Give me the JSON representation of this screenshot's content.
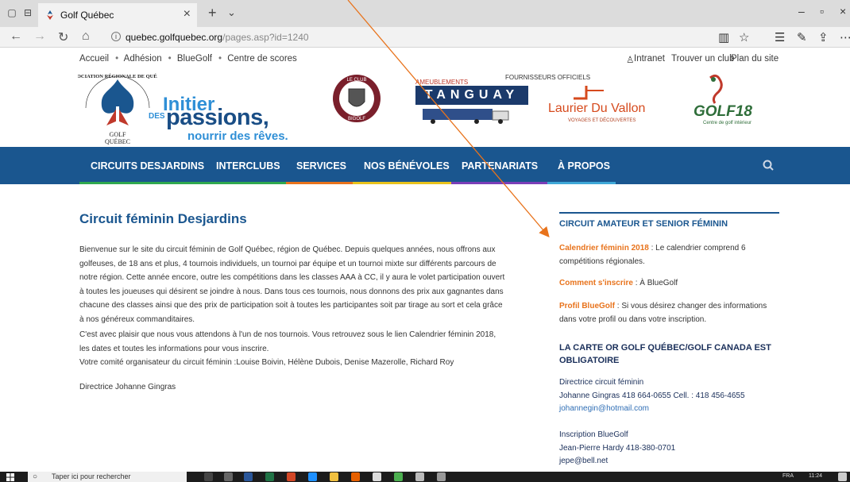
{
  "browser": {
    "tab_title": "Golf Québec",
    "url_host": "quebec.golfquebec.org",
    "url_path": "/pages.asp?id=1240"
  },
  "site": {
    "topnav": [
      "Accueil",
      "Adhésion",
      "BlueGolf",
      "Centre de scores"
    ],
    "topright": [
      "Intranet",
      "Trouver un club",
      "Plan du site"
    ],
    "slogan": {
      "line1": "Initier",
      "des": "DES",
      "line2": "passions,",
      "line3": "nourrir des rêves."
    },
    "aqr_bottom": "GOLF\nQUÉBEC",
    "sponsors": {
      "fournisseurs": "FOURNISSEURS OFFICIELS",
      "meublements": "AMEUBLEMENTS",
      "tanguay": "TANGUAY",
      "laurier": "Laurier Du Vallon",
      "laurier_sub": "VOYAGES ET DÉCOUVERTES",
      "golf18": "GOLF18",
      "golf18_sub": "Centre de golf intérieur"
    },
    "mainnav": [
      {
        "label": "CIRCUITS DESJARDINS",
        "color": "#2fa84f"
      },
      {
        "label": "INTERCLUBS",
        "color": "#2fa84f"
      },
      {
        "label": "SERVICES",
        "color": "#e8731c"
      },
      {
        "label": "NOS BÉNÉVOLES",
        "color": "#e8c21c"
      },
      {
        "label": "PARTENARIATS",
        "color": "#7a3fb8"
      },
      {
        "label": "À PROPOS",
        "color": "#3fa8d8"
      }
    ]
  },
  "content": {
    "title": "Circuit féminin Desjardins",
    "para1": [
      "Bienvenue sur le site du circuit féminin de Golf Québec, région de Québec. Depuis quelques années, nous offrons aux",
      "golfeuses, de 18 ans et plus, 4 tournois individuels, un tournoi par équipe et un tournoi mixte sur différents parcours de",
      "notre région. Cette année encore, outre les compétitions dans les classes AAA à CC, il y aura le volet participation ouvert",
      "à toutes les joueuses qui désirent se joindre à nous. Dans tous ces tournois, nous donnons des prix aux gagnantes dans",
      "chacune des classes ainsi que des prix de participation soit à toutes les participantes soit par tirage au sort et cela grâce",
      "à nos généreux commanditaires."
    ],
    "para2": [
      "C'est avec plaisir que nous vous attendons à l'un de nos tournois. Vous retrouvez  sous le lien Calendrier féminin  2018,",
      "les dates et toutes les informations pour vous inscrire.",
      "Votre comité organisateur du circuit féminin :Louise Boivin, Hélène Dubois, Denise Mazerolle, Richard Roy"
    ],
    "signature": "Directrice Johanne Gingras"
  },
  "sidebar": {
    "heading1": "CIRCUIT AMATEUR ET SENIOR FÉMININ",
    "cal_link": "Calendrier féminin 2018",
    "cal_text1": " : Le calendrier comprend  6",
    "cal_text2": "compétitions régionales.",
    "inscr_link": "Comment s'inscrire",
    "inscr_text": " : À BlueGolf",
    "profil_link": "Profil BlueGolf",
    "profil_text1": " : Si vous désirez changer des informations",
    "profil_text2": "dans votre profil ou dans votre inscription.",
    "heading2_l1": "LA CARTE OR GOLF QUÉBEC/GOLF CANADA EST",
    "heading2_l2": "OBLIGATOIRE",
    "dir_title": "Directrice circuit féminin",
    "dir_contact": "Johanne Gingras 418 664-0655 Cell. : 418 456-4655",
    "dir_email": "johannegin@hotmail.com",
    "insc_title": "Inscription BlueGolf",
    "insc_contact": "Jean-Pierre Hardy 418-380-0701",
    "insc_email": "jepe@bell.net"
  },
  "taskbar": {
    "search_placeholder": "Taper ici pour rechercher",
    "lang": "FRA",
    "time": "11:24"
  }
}
